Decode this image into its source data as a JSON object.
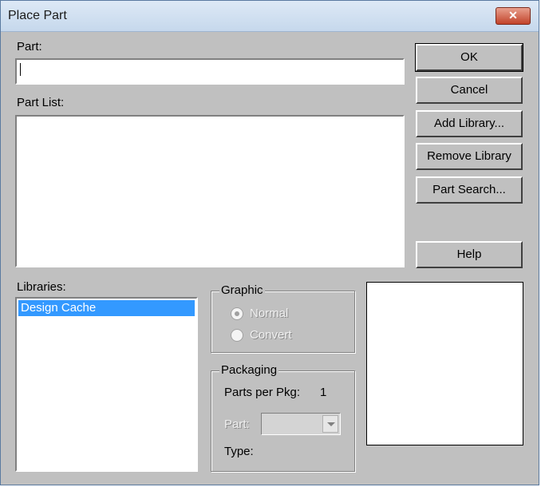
{
  "window": {
    "title": "Place Part",
    "close_glyph": "✕"
  },
  "part": {
    "label": "Part:",
    "value": ""
  },
  "part_list": {
    "label": "Part List:"
  },
  "buttons": {
    "ok": "OK",
    "cancel": "Cancel",
    "add_library": "Add Library...",
    "remove_library": "Remove Library",
    "part_search": "Part Search...",
    "help": "Help"
  },
  "libraries": {
    "label": "Libraries:",
    "items": [
      "Design Cache"
    ],
    "selected": "Design Cache"
  },
  "graphic": {
    "title": "Graphic",
    "options": [
      "Normal",
      "Convert"
    ],
    "selected": "Normal"
  },
  "packaging": {
    "title": "Packaging",
    "parts_per_pkg_label": "Parts per Pkg:",
    "parts_per_pkg_value": "1",
    "part_label": "Part:",
    "type_label": "Type:"
  },
  "colors": {
    "face": "#c0c0c0",
    "selection": "#3399ff"
  },
  "icons": {
    "close": "close-icon",
    "combo_arrow": "chevron-down-icon"
  }
}
